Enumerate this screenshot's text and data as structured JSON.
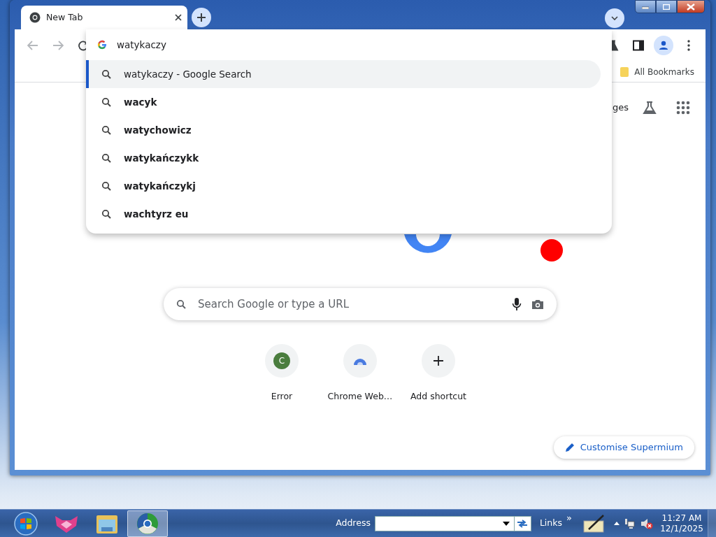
{
  "tab": {
    "title": "New Tab",
    "selected": true
  },
  "omnibox": {
    "value": "watykaczy"
  },
  "suggestions": [
    {
      "text": "watykaczy - Google Search",
      "kind": "typed",
      "selected": true
    },
    {
      "text": "wacyk",
      "kind": "suggestion",
      "selected": false
    },
    {
      "text": "watychowicz",
      "kind": "suggestion",
      "selected": false
    },
    {
      "text": "watykańczykk",
      "kind": "suggestion",
      "selected": false
    },
    {
      "text": "watykańczykj",
      "kind": "suggestion",
      "selected": false
    },
    {
      "text": "wachtyrz eu",
      "kind": "suggestion",
      "selected": false
    }
  ],
  "bookmarks_bar": {
    "folder": "All Bookmarks"
  },
  "page": {
    "header_link": "ges",
    "search": {
      "placeholder": "Search Google or type a URL"
    },
    "shortcuts": [
      {
        "label": "Error",
        "kind": "letter",
        "letter": "C"
      },
      {
        "label": "Chrome Web…",
        "kind": "site"
      },
      {
        "label": "Add shortcut",
        "kind": "add"
      }
    ],
    "customise_button": "Customise Supermium"
  },
  "taskbar": {
    "address_label": "Address",
    "links_label": "Links",
    "chevron": "»",
    "time": "11:27 AM",
    "date": "12/1/2025"
  }
}
